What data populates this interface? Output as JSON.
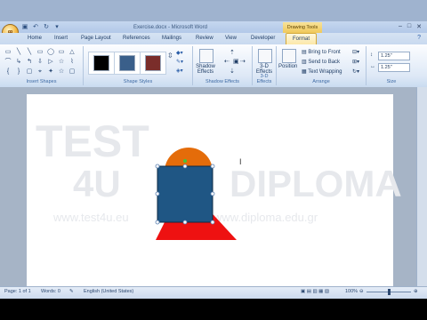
{
  "window": {
    "office_button": "⊞",
    "title": "Exercise.docx - Microsoft Word",
    "context_tool": "Drawing Tools",
    "controls": [
      "–",
      "□",
      "✕"
    ]
  },
  "tabs": [
    {
      "label": "Home"
    },
    {
      "label": "Insert"
    },
    {
      "label": "Page Layout"
    },
    {
      "label": "References"
    },
    {
      "label": "Mailings"
    },
    {
      "label": "Review"
    },
    {
      "label": "View"
    },
    {
      "label": "Developer"
    },
    {
      "label": "Format"
    }
  ],
  "help": "?",
  "ribbon": {
    "insert_shapes": {
      "label": "Insert Shapes",
      "shapes": [
        "▭",
        "╲",
        "╲",
        "▭",
        "◯",
        "▭",
        "△",
        "⌒",
        "↳",
        "↰",
        "⇩",
        "▷",
        "☆",
        "⌇",
        "{",
        "}",
        "▢",
        "⌖",
        "✦",
        "☆",
        "▢"
      ]
    },
    "shape_styles": {
      "label": "Shape Styles",
      "swatches": [
        {
          "color": "#000000"
        },
        {
          "color": "#3a5f8a"
        },
        {
          "color": "#7a2d2a"
        }
      ]
    },
    "shadow_effects": {
      "label": "Shadow Effects",
      "shadow_button": "Shadow Effects"
    },
    "effects_3d": {
      "label": "3-D Effects",
      "button": "3-D Effects"
    },
    "arrange": {
      "label": "Arrange",
      "position": "Position",
      "bring_to_front": "Bring to Front",
      "send_to_back": "Send to Back",
      "text_wrapping": "Text Wrapping"
    },
    "size": {
      "label": "Size",
      "height": "1.25\"",
      "width": "1.25\""
    }
  },
  "watermark": {
    "test": "TEST",
    "four_u": "4U",
    "diploma": "DIPLOMA",
    "url_left": "www.test4u.eu",
    "url_right": "www.diploma.edu.gr"
  },
  "shapes": {
    "circle_color": "#e46c0a",
    "square_color": "#1f5684",
    "triangle_color": "#ee1111"
  },
  "status": {
    "page": "Page: 1 of 1",
    "words": "Words: 0",
    "language": "English (United States)",
    "zoom": "100%"
  },
  "colors": {
    "accent": "#f0c95a",
    "ribbon": "#dde8f6"
  }
}
